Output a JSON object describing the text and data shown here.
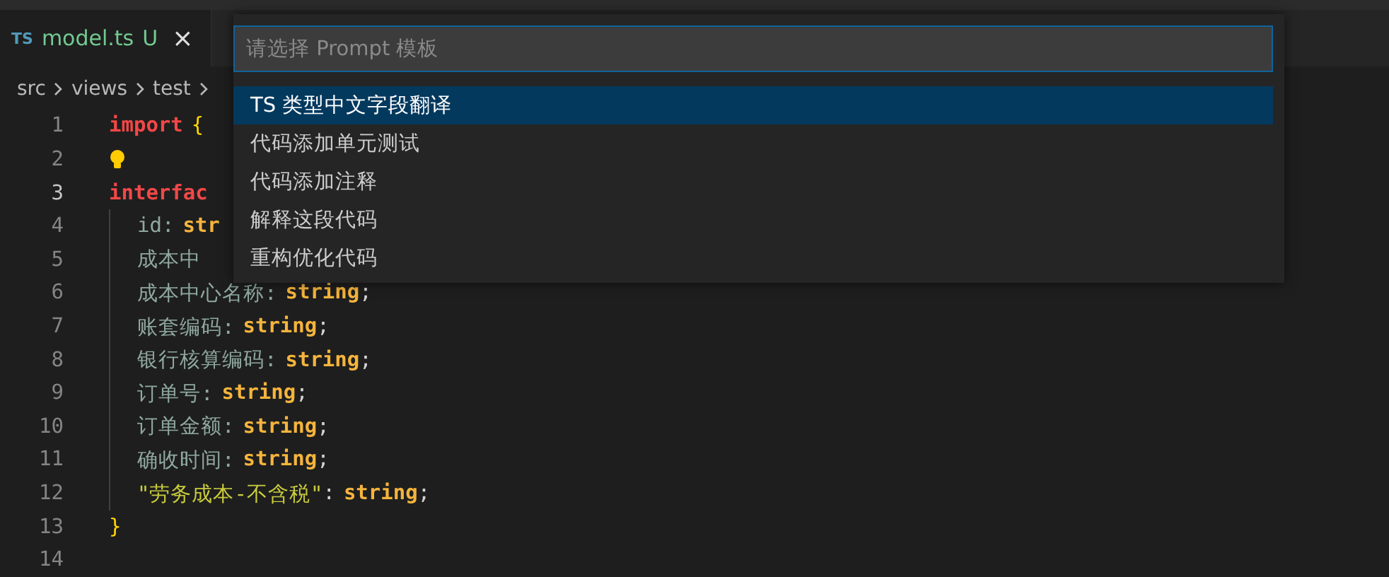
{
  "tabs": [
    {
      "badge": "TS",
      "name": "model.ts",
      "status": "U",
      "close": "×",
      "selected": true
    }
  ],
  "breadcrumb": [
    "src",
    "views",
    "test"
  ],
  "editor": {
    "lines": [
      {
        "number": "1",
        "current": false,
        "lightbulb": false,
        "indented": false,
        "tokens": [
          {
            "kind": "keyword",
            "text": "import"
          },
          {
            "kind": "brace",
            "text": "{"
          }
        ]
      },
      {
        "number": "2",
        "current": false,
        "lightbulb": true,
        "indented": false
      },
      {
        "number": "3",
        "current": true,
        "lightbulb": false,
        "indented": false,
        "tokens": [
          {
            "kind": "keyword",
            "text": "interfac"
          }
        ]
      },
      {
        "number": "4",
        "current": false,
        "lightbulb": false,
        "indented": true,
        "tokens": [
          {
            "kind": "prop",
            "text": "id:"
          },
          {
            "kind": "type",
            "text": "str"
          }
        ]
      },
      {
        "number": "5",
        "current": false,
        "lightbulb": false,
        "indented": true,
        "tokens": [
          {
            "kind": "prop",
            "text": "成本中"
          }
        ]
      },
      {
        "number": "6",
        "current": false,
        "lightbulb": false,
        "indented": true,
        "tokens": [
          {
            "kind": "prop",
            "text": "成本中心名称:"
          },
          {
            "kind": "type",
            "text": "string"
          },
          {
            "kind": "punct",
            "text": ";"
          }
        ]
      },
      {
        "number": "7",
        "current": false,
        "lightbulb": false,
        "indented": true,
        "tokens": [
          {
            "kind": "prop",
            "text": "账套编码:"
          },
          {
            "kind": "type",
            "text": "string"
          },
          {
            "kind": "punct",
            "text": ";"
          }
        ]
      },
      {
        "number": "8",
        "current": false,
        "lightbulb": false,
        "indented": true,
        "tokens": [
          {
            "kind": "prop",
            "text": "银行核算编码:"
          },
          {
            "kind": "type",
            "text": "string"
          },
          {
            "kind": "punct",
            "text": ";"
          }
        ]
      },
      {
        "number": "9",
        "current": false,
        "lightbulb": false,
        "indented": true,
        "tokens": [
          {
            "kind": "prop",
            "text": "订单号:"
          },
          {
            "kind": "type",
            "text": "string"
          },
          {
            "kind": "punct",
            "text": ";"
          }
        ]
      },
      {
        "number": "10",
        "current": false,
        "lightbulb": false,
        "indented": true,
        "tokens": [
          {
            "kind": "prop",
            "text": "订单金额:"
          },
          {
            "kind": "type",
            "text": "string"
          },
          {
            "kind": "punct",
            "text": ";"
          }
        ]
      },
      {
        "number": "11",
        "current": false,
        "lightbulb": false,
        "indented": true,
        "tokens": [
          {
            "kind": "prop",
            "text": "确收时间:"
          },
          {
            "kind": "type",
            "text": "string"
          },
          {
            "kind": "punct",
            "text": ";"
          }
        ]
      },
      {
        "number": "12",
        "current": false,
        "lightbulb": false,
        "indented": true,
        "tokens": [
          {
            "kind": "string",
            "text": "\"劳务成本-不含税\""
          },
          {
            "kind": "punct",
            "text": ":"
          },
          {
            "kind": "type",
            "text": "string"
          },
          {
            "kind": "punct",
            "text": ";"
          }
        ]
      },
      {
        "number": "13",
        "current": false,
        "lightbulb": false,
        "indented": false,
        "tokens": [
          {
            "kind": "brace",
            "text": "}"
          }
        ]
      },
      {
        "number": "14",
        "current": false,
        "lightbulb": false,
        "indented": false
      }
    ]
  },
  "quick_pick": {
    "placeholder": "请选择 Prompt 模板",
    "items": [
      {
        "label": "TS 类型中文字段翻译",
        "selected": true
      },
      {
        "label": "代码添加单元测试",
        "selected": false
      },
      {
        "label": "代码添加注释",
        "selected": false
      },
      {
        "label": "解释这段代码",
        "selected": false
      },
      {
        "label": "重构优化代码",
        "selected": false
      }
    ]
  }
}
